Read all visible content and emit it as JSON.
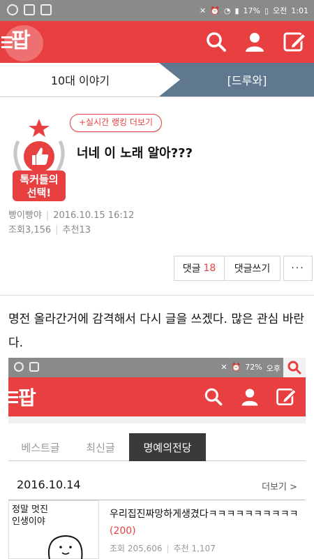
{
  "status_bar": {
    "battery": "17%",
    "time_label": "오전",
    "time": "1:01"
  },
  "app": {
    "logo_text": "팝"
  },
  "tabs": {
    "left_label": "10대 이야기",
    "right_label": "[드루와]"
  },
  "post": {
    "rank_pill": "+실시간 랭킹 더보기",
    "badge_text_line1": "톡커들의",
    "badge_text_line2": "선택!",
    "title": "너네 이 노래 알아???",
    "author": "빵이빵야",
    "datetime": "2016.10.15 16:12",
    "views_label": "조회",
    "views": "3,156",
    "recommend_label": "추천",
    "recommend": "13"
  },
  "actions": {
    "comments_label": "댓글",
    "comments_count": "18",
    "write_comment_label": "댓글쓰기",
    "more_label": "···"
  },
  "body": {
    "text": "명전 올라간거에 감격해서 다시 글을 쓰겠다. 많은 관심 바란다."
  },
  "embedded": {
    "status": {
      "battery": "72%",
      "time": "오후"
    },
    "logo_text": "팝",
    "tabs": [
      "베스트글",
      "최신글",
      "명예의전당"
    ],
    "date": "2016.10.14",
    "more_label": "더보기 >",
    "thumb_text_line1": "정말 멋진",
    "thumb_text_line2": "인생이야",
    "item_title": "우리집진짜망하게생겼다ㅋㅋㅋㅋㅋㅋㅋㅋㅋㅋ",
    "item_count": "(200)",
    "item_views": "조회 205,606",
    "item_recommend": "추천 1,107"
  },
  "colors": {
    "brand_red": "#e84040",
    "tab_slate": "#5f7890",
    "status_gray": "#8a8a8a"
  }
}
